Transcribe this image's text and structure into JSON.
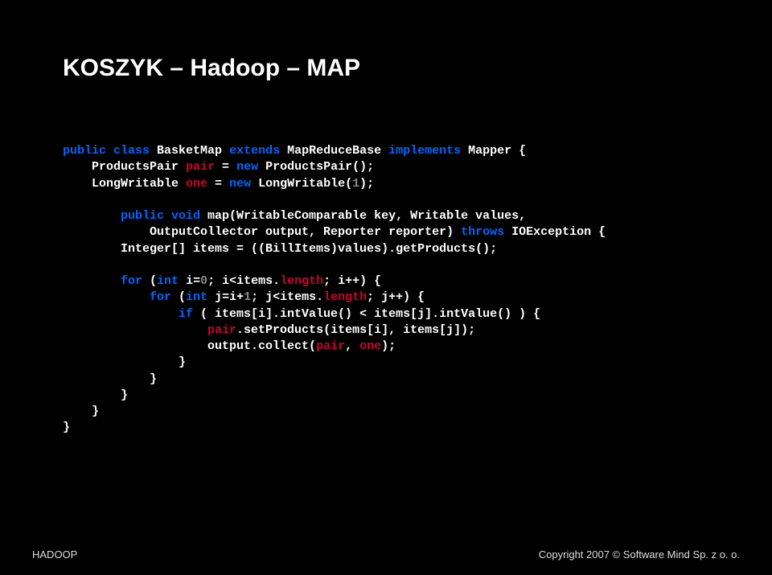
{
  "title": "KOSZYK – Hadoop – MAP",
  "code": {
    "l1": {
      "t1": "public class",
      "t2": " BasketMap ",
      "t3": "extends",
      "t4": " MapReduceBase ",
      "t5": "implements",
      "t6": " Mapper {"
    },
    "l2": {
      "t1": "    ProductsPair ",
      "t2": "pair",
      "t3": " = ",
      "t4": "new",
      "t5": " ProductsPair();"
    },
    "l3": {
      "t1": "    LongWritable ",
      "t2": "one",
      "t3": " = ",
      "t4": "new",
      "t5": " LongWritable(",
      "t6": "1",
      "t7": ");"
    },
    "l4": "",
    "l5": {
      "t1": "        public void",
      "t2": " map(WritableComparable key, Writable values,"
    },
    "l6": {
      "t1": "            OutputCollector output, Reporter reporter) ",
      "t2": "throws",
      "t3": " IOException {"
    },
    "l7": {
      "t1": "        Integer[] items = ((BillItems)values).getProducts();"
    },
    "l8": "",
    "l9": {
      "t1": "        for",
      "t2": " (",
      "t3": "int",
      "t4": " i=",
      "t5": "0",
      "t6": "; i<items.",
      "t7": "length",
      "t8": "; i++) {"
    },
    "l10": {
      "t1": "            for",
      "t2": " (",
      "t3": "int",
      "t4": " j=i+",
      "t5": "1",
      "t6": "; j<items.",
      "t7": "length",
      "t8": "; j++) {"
    },
    "l11": {
      "t1": "                if",
      "t2": " ( items[i].intValue() < items[j].intValue() ) {"
    },
    "l12": {
      "t1": "                    ",
      "t2": "pair",
      "t3": ".setProducts(items[i], items[j]);"
    },
    "l13": {
      "t1": "                    output.collect(",
      "t2": "pair",
      "t3": ", ",
      "t4": "one",
      "t5": ");"
    },
    "l14": "                }",
    "l15": "            }",
    "l16": "        }",
    "l17": "    }",
    "l18": "}"
  },
  "footer": {
    "left": "HADOOP",
    "right": "Copyright 2007 © Software Mind Sp. z o. o."
  }
}
